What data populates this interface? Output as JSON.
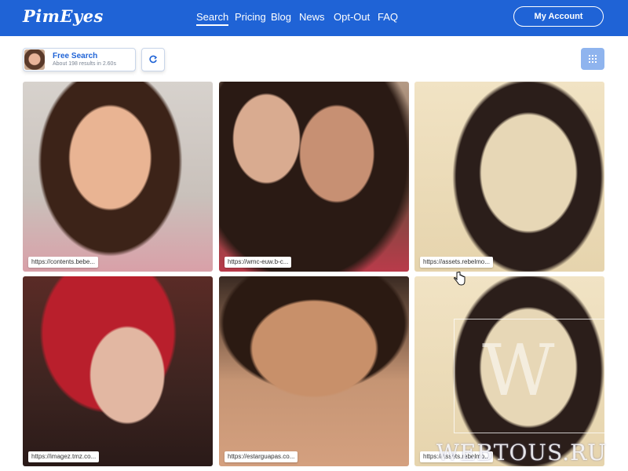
{
  "brand": {
    "logo_text": "PimEyes"
  },
  "nav": {
    "items": [
      {
        "label": "Search",
        "active": true
      },
      {
        "label": "Pricing"
      },
      {
        "label": "Blog"
      },
      {
        "label": "News"
      },
      {
        "label": "Opt-Out"
      },
      {
        "label": "FAQ"
      }
    ],
    "account_label": "My Account"
  },
  "search": {
    "title": "Free Search",
    "subtitle": "About 198 results in 2.60s"
  },
  "results": [
    {
      "url": "https://contents.bebe..."
    },
    {
      "url": "https://wmc-euw.b-c..."
    },
    {
      "url": "https://assets.rebelmo..."
    },
    {
      "url": "https://imagez.tmz.co..."
    },
    {
      "url": "https://estarguapas.co..."
    },
    {
      "url": "https://assets.rebelmo..."
    }
  ],
  "watermark": {
    "letter": "W",
    "text": "WEBTOUS.RU"
  },
  "colors": {
    "header": "#1f63d6",
    "accent": "#1f63d6",
    "grid_toggle": "#8fb4ee"
  },
  "icons": {
    "refresh": "refresh-icon",
    "grid": "grid-icon",
    "cursor": "hand-cursor-icon"
  }
}
